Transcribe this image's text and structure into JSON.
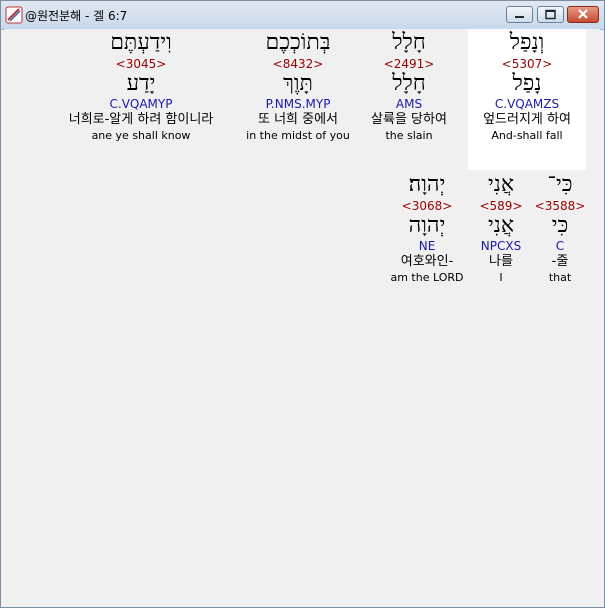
{
  "window": {
    "title": "@원전분해 - 겔 6:7"
  },
  "words": [
    {
      "hebrew": "וְנָפַל",
      "strong": "<5307>",
      "lemma": "נָפַל",
      "morph": "C.VQAMZS",
      "korean": "엎드러지게 하여",
      "english": "And-shall fall",
      "highlighted": true
    },
    {
      "hebrew": "חָלָל",
      "strong": "<2491>",
      "lemma": "חָלָל",
      "morph": "AMS",
      "korean": "살륙을 당하여",
      "english": "the slain",
      "highlighted": false
    },
    {
      "hebrew": "בְּתוֹכְכֶם",
      "strong": "<8432>",
      "lemma": "תָּוֶךְ",
      "morph": "P.NMS.MYP",
      "korean": "또 너희 중에서",
      "english": "in the midst of you",
      "highlighted": false
    },
    {
      "hebrew": "וִידַעְתֶּם",
      "strong": "<3045>",
      "lemma": "יָדַע",
      "morph": "C.VQAMYP",
      "korean": "너희로-알게 하려 함이니라",
      "english": "ane ye shall know",
      "highlighted": false
    },
    {
      "hebrew": "כִּי־",
      "strong": "<3588>",
      "lemma": "כִּי",
      "morph": "C",
      "korean": "-줄",
      "english": "that",
      "highlighted": false
    },
    {
      "hebrew": "אֲנִי",
      "strong": "<589>",
      "lemma": "אֲנִי",
      "morph": "NPCXS",
      "korean": "나를",
      "english": "I",
      "highlighted": false
    },
    {
      "hebrew": "יְהוָה׃",
      "strong": "<3068>",
      "lemma": "יְהוָה",
      "morph": "NE",
      "korean": "여호와인-",
      "english": "am the LORD",
      "highlighted": false
    }
  ]
}
